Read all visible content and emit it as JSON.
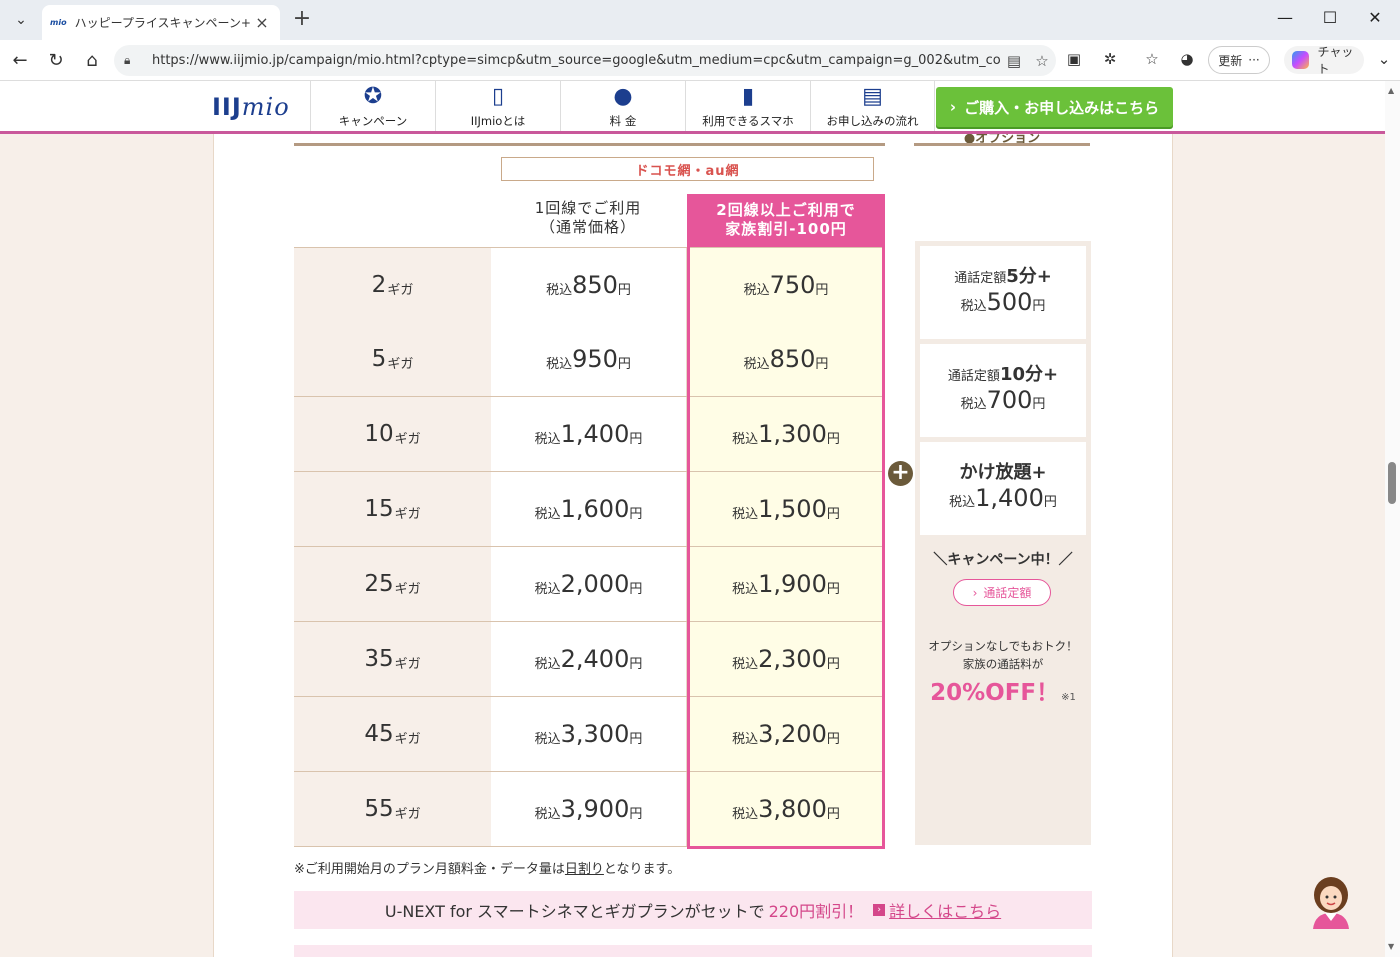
{
  "browser": {
    "tab_title": "ハッピープライスキャンペーン+ | IIJmio",
    "tab_favicon": "mio",
    "url": "https://www.iijmio.jp/campaign/mio.html?cptype=simcp&utm_source=google&utm_medium=cpc&utm_campaign=g_002&utm_conte...",
    "update_label": "更新",
    "copilot_label": "チャット"
  },
  "site": {
    "logo": "IIJ",
    "logo_suffix": "mio",
    "nav": [
      {
        "label": "キャンペーン",
        "icon": "campaign-yen-icon"
      },
      {
        "label": "IIJmioとは",
        "icon": "phone-icon"
      },
      {
        "label": "料 金",
        "icon": "purse-icon"
      },
      {
        "label": "利用できるスマホ",
        "icon": "smartphone-ok-icon"
      },
      {
        "label": "お申し込みの流れ",
        "icon": "document-icon"
      }
    ],
    "cta": "ご購入・お申し込みはこちら",
    "accent": "#e6569a",
    "cta_color": "#6bc13a"
  },
  "plans": {
    "network_label": "ドコモ網・au網",
    "col1_line1": "1回線でご利用",
    "col1_line2": "（通常価格）",
    "col2_line1": "2回線以上ご利用で",
    "col2_line2": "家族割引-100円",
    "tax_label": "税込",
    "yen": "円",
    "giga": "ギガ",
    "rows": [
      {
        "gb": "2",
        "normal": "850",
        "family": "750"
      },
      {
        "gb": "5",
        "normal": "950",
        "family": "850"
      },
      {
        "gb": "10",
        "normal": "1,400",
        "family": "1,300"
      },
      {
        "gb": "15",
        "normal": "1,600",
        "family": "1,500"
      },
      {
        "gb": "25",
        "normal": "2,000",
        "family": "1,900"
      },
      {
        "gb": "35",
        "normal": "2,400",
        "family": "2,300"
      },
      {
        "gb": "45",
        "normal": "3,300",
        "family": "3,200"
      },
      {
        "gb": "55",
        "normal": "3,900",
        "family": "3,800"
      }
    ]
  },
  "options": {
    "cards": [
      {
        "prefix": "通話定額",
        "bold": "5分+",
        "price": "500"
      },
      {
        "prefix": "通話定額",
        "bold": "10分+",
        "price": "700"
      },
      {
        "prefix": "",
        "bold": "かけ放題+",
        "price": "1,400"
      }
    ],
    "campaign_label": "＼キャンペーン中！／",
    "button_label": "通話定額",
    "note_line1": "オプションなしでもおトク！",
    "note_line2": "家族の通話料が",
    "off_label": "20%OFF！",
    "off_note": "※1"
  },
  "footnote": {
    "text_before": "※ご利用開始月のプラン月額料金・データ量は",
    "link": "日割り",
    "text_after": "となります。"
  },
  "unext": {
    "text": "U-NEXT for スマートシネマとギガプランがセットで",
    "highlight": "220円割引！",
    "link": "詳しくはこちら"
  }
}
